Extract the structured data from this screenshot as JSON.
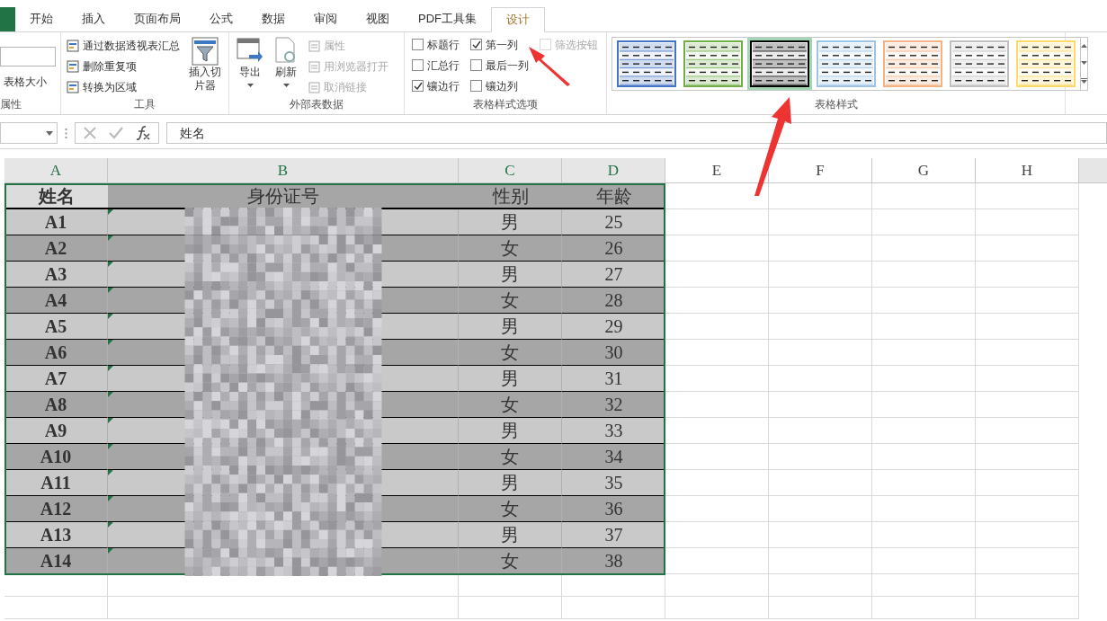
{
  "ribbon": {
    "tabs": [
      {
        "label": "开始",
        "selected": false
      },
      {
        "label": "插入",
        "selected": false
      },
      {
        "label": "页面布局",
        "selected": false
      },
      {
        "label": "公式",
        "selected": false
      },
      {
        "label": "数据",
        "selected": false
      },
      {
        "label": "审阅",
        "selected": false
      },
      {
        "label": "视图",
        "selected": false
      },
      {
        "label": "PDF工具集",
        "selected": false
      },
      {
        "label": "设计",
        "selected": true
      }
    ],
    "properties": {
      "label": "属性",
      "resize": "表格大小"
    },
    "tools": {
      "label": "工具",
      "items": [
        {
          "label": "通过数据透视表汇总"
        },
        {
          "label": "删除重复项"
        },
        {
          "label": "转换为区域"
        }
      ],
      "slicer": "插入切片器"
    },
    "external": {
      "label": "外部表数据",
      "export": "导出",
      "refresh": "刷新",
      "items": [
        {
          "label": "属性",
          "disabled": true
        },
        {
          "label": "用浏览器打开",
          "disabled": true
        },
        {
          "label": "取消链接",
          "disabled": true
        }
      ]
    },
    "options": {
      "label": "表格样式选项",
      "items": [
        {
          "label": "标题行",
          "checked": false,
          "disabled": false
        },
        {
          "label": "汇总行",
          "checked": false,
          "disabled": false
        },
        {
          "label": "镶边行",
          "checked": true,
          "disabled": false
        },
        {
          "label": "第一列",
          "checked": true,
          "disabled": false
        },
        {
          "label": "最后一列",
          "checked": false,
          "disabled": false
        },
        {
          "label": "镶边列",
          "checked": false,
          "disabled": false
        },
        {
          "label": "筛选按钮",
          "checked": false,
          "disabled": true
        }
      ]
    },
    "styles": {
      "label": "表格样式",
      "items": [
        {
          "color": "#4472c4",
          "selected": false
        },
        {
          "color": "#70ad47",
          "selected": false
        },
        {
          "color": "#000000",
          "selected": true
        },
        {
          "color": "#9dc3e6",
          "selected": false
        },
        {
          "color": "#f4b183",
          "selected": false
        },
        {
          "color": "#bfbfbf",
          "selected": false
        },
        {
          "color": "#ffd966",
          "selected": false
        }
      ]
    }
  },
  "formula_bar": {
    "value": "姓名"
  },
  "sheet": {
    "columns": [
      "A",
      "B",
      "C",
      "D",
      "E",
      "F",
      "G",
      "H"
    ],
    "header": [
      "姓名",
      "身份证号",
      "性别",
      "年龄"
    ],
    "rows": [
      {
        "name": "A1",
        "gender": "男",
        "age": "25"
      },
      {
        "name": "A2",
        "gender": "女",
        "age": "26"
      },
      {
        "name": "A3",
        "gender": "男",
        "age": "27"
      },
      {
        "name": "A4",
        "gender": "女",
        "age": "28"
      },
      {
        "name": "A5",
        "gender": "男",
        "age": "29"
      },
      {
        "name": "A6",
        "gender": "女",
        "age": "30"
      },
      {
        "name": "A7",
        "gender": "男",
        "age": "31"
      },
      {
        "name": "A8",
        "gender": "女",
        "age": "32"
      },
      {
        "name": "A9",
        "gender": "男",
        "age": "33"
      },
      {
        "name": "A10",
        "gender": "女",
        "age": "34"
      },
      {
        "name": "A11",
        "gender": "男",
        "age": "35"
      },
      {
        "name": "A12",
        "gender": "女",
        "age": "36"
      },
      {
        "name": "A13",
        "gender": "男",
        "age": "37"
      },
      {
        "name": "A14",
        "gender": "女",
        "age": "38"
      }
    ]
  }
}
